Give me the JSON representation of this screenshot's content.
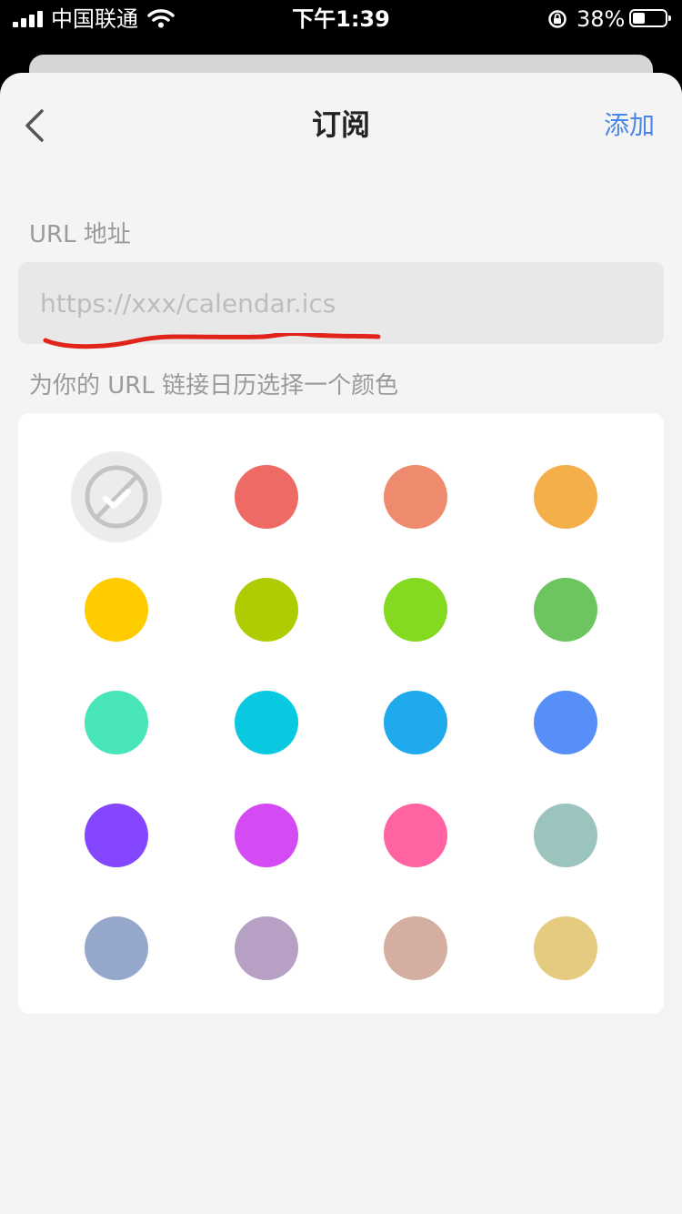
{
  "status_bar": {
    "carrier": "中国联通",
    "time": "下午1:39",
    "battery_percent": "38%",
    "battery_level": 0.38,
    "icons": [
      "signal-icon",
      "wifi-icon",
      "rotation-lock-icon",
      "battery-icon"
    ]
  },
  "header": {
    "title": "订阅",
    "add_label": "添加",
    "back_icon": "chevron-left-icon"
  },
  "url_section": {
    "label": "URL 地址",
    "value": "",
    "placeholder": "https://xxx/calendar.ics"
  },
  "color_section": {
    "label": "为你的 URL 链接日历选择一个颜色",
    "selected": "none",
    "none_icon": "no-color-check-icon",
    "colors": [
      "#EE6B65",
      "#EE8B6E",
      "#F4AF4A",
      "#FFCC00",
      "#AFCB02",
      "#84DA20",
      "#6DC560",
      "#48E5B8",
      "#09C9E1",
      "#1FAAED",
      "#568FF7",
      "#8447FF",
      "#D54BF3",
      "#FF63A1",
      "#9BC4BF",
      "#95A8CB",
      "#B6A1C4",
      "#D4AEA1",
      "#E5CB80"
    ]
  },
  "colors": {
    "accent": "#4A86E8",
    "annotation": "#E2231A"
  }
}
